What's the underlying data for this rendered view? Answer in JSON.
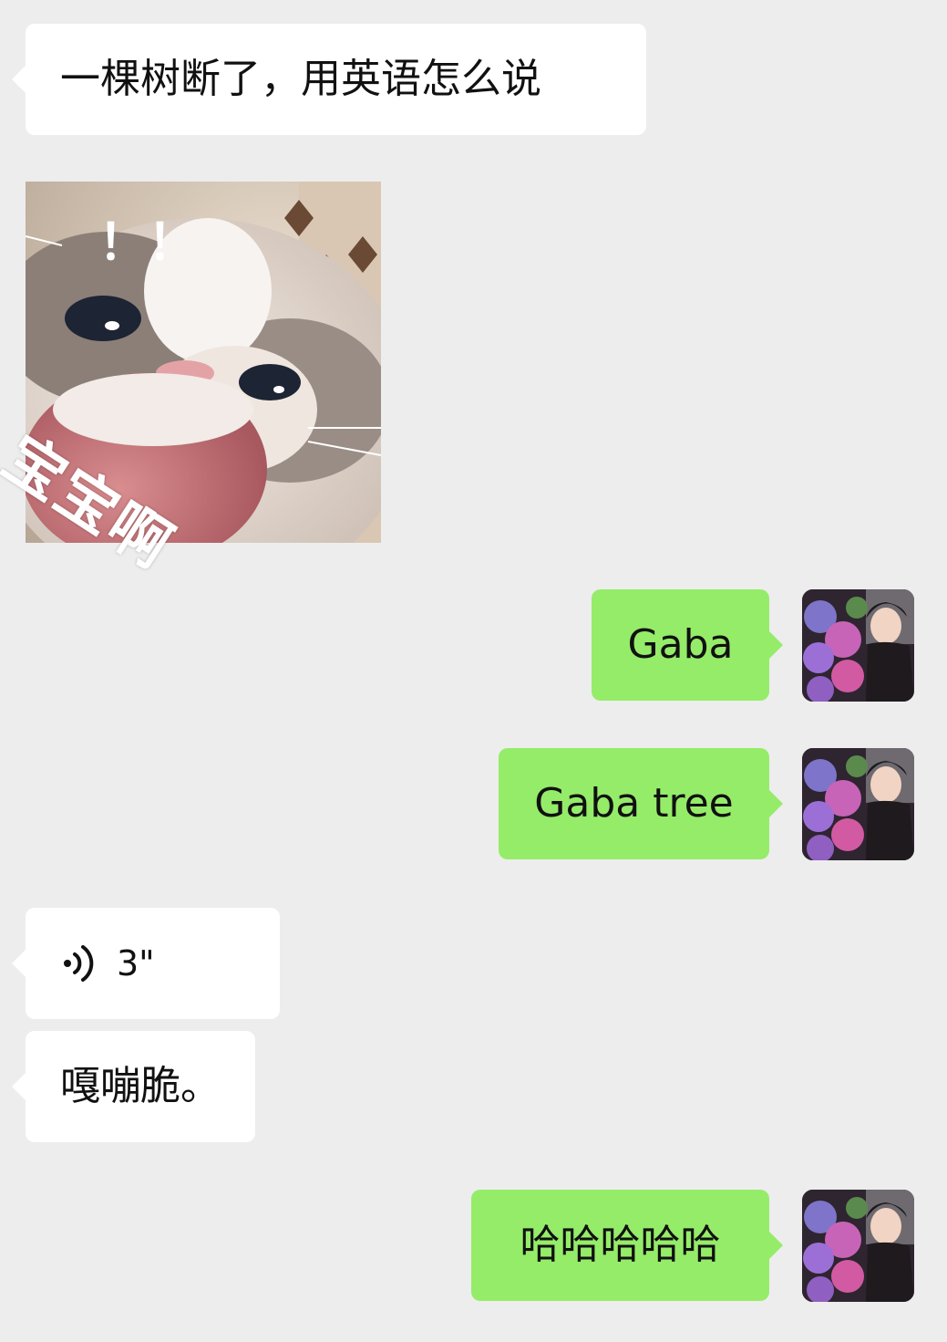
{
  "messages": {
    "m1_text": "一棵树断了，用英语怎么说",
    "sticker_text": "宝宝啊",
    "sticker_exclaim": "！！",
    "m3_text": "Gaba",
    "m4_text": "Gaba tree",
    "voice_duration": "3\"",
    "m6_text": "嘎嘣脆。",
    "m7_text": "哈哈哈哈哈"
  },
  "colors": {
    "background": "#ededed",
    "incoming_bubble": "#ffffff",
    "outgoing_bubble": "#95ec69"
  },
  "icons": {
    "voice": "voice-wave-icon",
    "avatar": "avatar-photo-flowers"
  }
}
